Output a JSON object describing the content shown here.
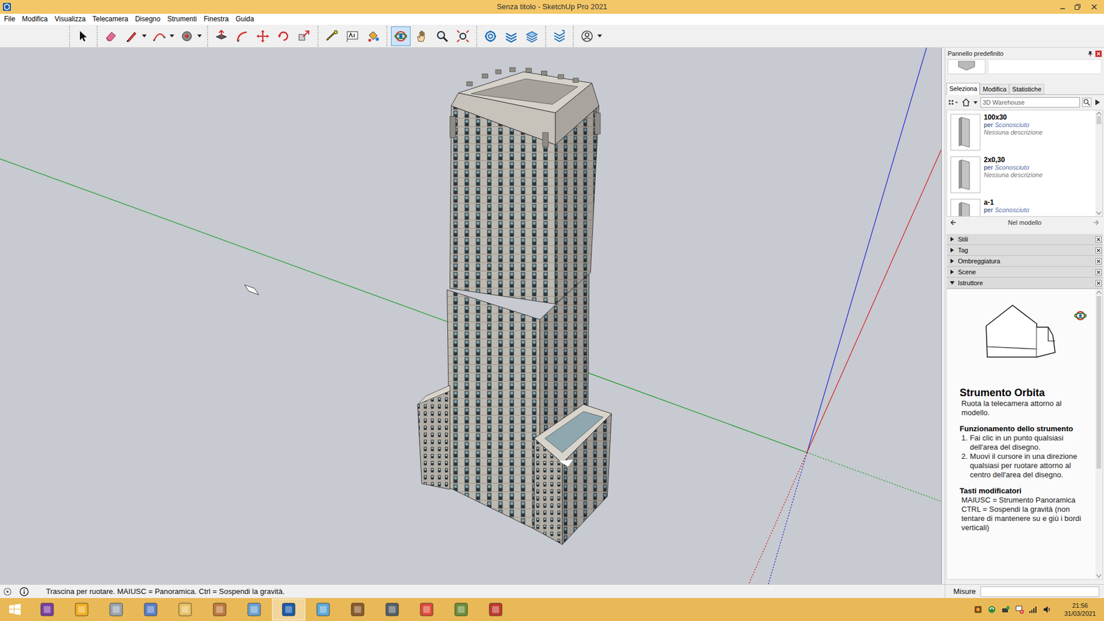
{
  "window": {
    "title": "Senza titolo - SketchUp Pro 2021"
  },
  "menu": [
    "File",
    "Modifica",
    "Visualizza",
    "Telecamera",
    "Disegno",
    "Strumenti",
    "Finestra",
    "Guida"
  ],
  "toolbar": [
    {
      "tools": [
        {
          "selected": false,
          "dropdown": false
        }
      ]
    },
    {
      "tools": [
        {
          "selected": false,
          "dropdown": false
        },
        {
          "selected": false,
          "dropdown": true
        },
        {
          "selected": false,
          "dropdown": true
        },
        {
          "selected": false,
          "dropdown": true
        }
      ]
    },
    {
      "tools": [
        {
          "selected": false,
          "dropdown": false
        },
        {
          "selected": false,
          "dropdown": false
        },
        {
          "selected": false,
          "dropdown": false
        },
        {
          "selected": false,
          "dropdown": false
        },
        {
          "selected": false,
          "dropdown": false
        }
      ]
    },
    {
      "tools": [
        {
          "selected": false,
          "dropdown": false
        },
        {
          "selected": false,
          "dropdown": false
        },
        {
          "selected": false,
          "dropdown": false
        }
      ]
    },
    {
      "tools": [
        {
          "selected": true,
          "dropdown": false
        },
        {
          "selected": false,
          "dropdown": false
        },
        {
          "selected": false,
          "dropdown": false
        },
        {
          "selected": false,
          "dropdown": false
        }
      ]
    },
    {
      "tools": [
        {
          "selected": false,
          "dropdown": false
        },
        {
          "selected": false,
          "dropdown": false
        },
        {
          "selected": false,
          "dropdown": false
        }
      ]
    },
    {
      "tools": [
        {
          "selected": false,
          "dropdown": false
        }
      ]
    },
    {
      "tools": [
        {
          "selected": false,
          "dropdown": true
        }
      ]
    }
  ],
  "tray": {
    "title": "Pannello predefinito",
    "tabs": [
      {
        "label": "Seleziona",
        "selected": true
      },
      {
        "label": "Modifica",
        "selected": false
      },
      {
        "label": "Statistiche",
        "selected": false
      }
    ],
    "search": {
      "placeholder": "3D Warehouse"
    },
    "components": [
      {
        "name": "100x30",
        "by": "per",
        "author": "Sconosciuto",
        "description": "Nessuna descrizione"
      },
      {
        "name": "2x0,30",
        "by": "per",
        "author": "Sconosciuto",
        "description": "Nessuna descrizione"
      },
      {
        "name": "a-1",
        "by": "per",
        "author": "Sconosciuto"
      }
    ],
    "nav_label": "Nel modello",
    "sections": [
      {
        "label": "Stili",
        "expanded": false
      },
      {
        "label": "Tag",
        "expanded": false
      },
      {
        "label": "Ombreggiatura",
        "expanded": false
      },
      {
        "label": "Scene",
        "expanded": false
      },
      {
        "label": "Istruttore",
        "expanded": true
      }
    ],
    "instructor": {
      "heading": "Strumento Orbita",
      "summary": "Ruota la telecamera attorno al modello.",
      "usage_heading": "Funzionamento dello strumento",
      "steps": [
        {
          "number": "1.",
          "text": "Fai clic in un punto qualsiasi dell'area del disegno."
        },
        {
          "number": "2.",
          "text": "Muovi il cursore in una direzione qualsiasi per ruotare attorno al centro dell'area del disegno."
        }
      ],
      "modifiers_heading": "Tasti modificatori",
      "modifiers": [
        "MAIUSC = Strumento Panoramica",
        "CTRL = Sospendi la gravità (non tentare di mantenere su e giù i bordi verticali)"
      ]
    }
  },
  "status_bar": {
    "hint": "Trascina per ruotare. MAIUSC = Panoramica. Ctrl = Sospendi la gravità.",
    "measurements_label": "Misure"
  },
  "taskbar": {
    "apps": [
      {
        "active": false
      },
      {
        "active": false
      },
      {
        "active": false
      },
      {
        "active": false
      },
      {
        "active": false
      },
      {
        "active": false
      },
      {
        "active": false
      },
      {
        "active": true
      },
      {
        "active": false
      },
      {
        "active": false
      },
      {
        "active": false
      },
      {
        "active": false
      },
      {
        "active": false
      },
      {
        "active": false
      }
    ],
    "time": "21:56",
    "date": "31/03/2021"
  }
}
